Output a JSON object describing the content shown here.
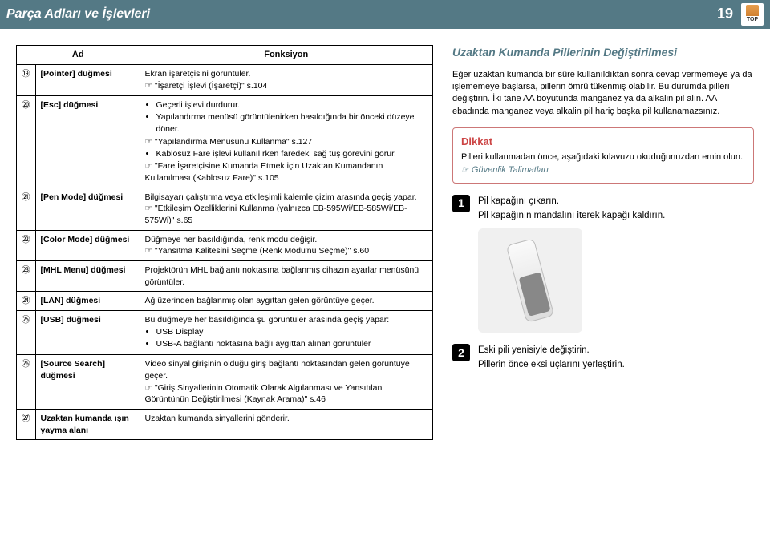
{
  "header": {
    "title": "Parça Adları ve İşlevleri",
    "page": "19",
    "logo": "TOP"
  },
  "table": {
    "col_name": "Ad",
    "col_func": "Fonksiyon",
    "rows": [
      {
        "num": "⑲",
        "name": "[Pointer] düğmesi",
        "func_text": "Ekran işaretçisini görüntüler.",
        "ref": "\"İşaretçi İşlevi (İşaretçi)\" s.104"
      },
      {
        "num": "⑳",
        "name": "[Esc] düğmesi",
        "bullets": [
          "Geçerli işlevi durdurur.",
          "Yapılandırma menüsü görüntülenirken basıldığında bir önceki düzeye döner."
        ],
        "ref1": "\"Yapılandırma Menüsünü Kullanma\" s.127",
        "bullets2": [
          "Kablosuz Fare işlevi kullanılırken faredeki sağ tuş görevini görür."
        ],
        "ref2": "\"Fare İşaretçisine Kumanda Etmek için Uzaktan Kumandanın Kullanılması (Kablosuz Fare)\" s.105"
      },
      {
        "num": "㉑",
        "name": "[Pen Mode] düğmesi",
        "func_text": "Bilgisayarı çalıştırma veya etkileşimli kalemle çizim arasında geçiş yapar.",
        "ref": "\"Etkileşim Özelliklerini Kullanma (yalnızca EB-595Wi/EB-585Wi/EB-575Wi)\" s.65"
      },
      {
        "num": "㉒",
        "name": "[Color Mode] düğmesi",
        "func_text": "Düğmeye her basıldığında, renk modu değişir.",
        "ref": "\"Yansıtma Kalitesini Seçme (Renk Modu'nu Seçme)\" s.60"
      },
      {
        "num": "㉓",
        "name": "[MHL Menu] düğmesi",
        "func_text": "Projektörün MHL bağlantı noktasına bağlanmış cihazın ayarlar menüsünü görüntüler."
      },
      {
        "num": "㉔",
        "name": "[LAN] düğmesi",
        "func_text": "Ağ üzerinden bağlanmış olan aygıttan gelen görüntüye geçer."
      },
      {
        "num": "㉕",
        "name": "[USB] düğmesi",
        "func_text": "Bu düğmeye her basıldığında şu görüntüler arasında geçiş yapar:",
        "bullets": [
          "USB Display",
          "USB-A bağlantı noktasına bağlı aygıttan alınan görüntüler"
        ]
      },
      {
        "num": "㉖",
        "name": "[Source Search] düğmesi",
        "func_text": "Video sinyal girişinin olduğu giriş bağlantı noktasından gelen görüntüye geçer.",
        "ref": "\"Giriş Sinyallerinin Otomatik Olarak Algılanması ve Yansıtılan Görüntünün Değiştirilmesi (Kaynak Arama)\" s.46"
      },
      {
        "num": "㉗",
        "name": "Uzaktan kumanda ışın yayma alanı",
        "func_text": "Uzaktan kumanda sinyallerini gönderir."
      }
    ]
  },
  "right": {
    "title": "Uzaktan Kumanda Pillerinin Değiştirilmesi",
    "para": "Eğer uzaktan kumanda bir süre kullanıldıktan sonra cevap vermemeye ya da işlememeye başlarsa, pillerin ömrü tükenmiş olabilir. Bu durumda pilleri değiştirin. İki tane AA boyutunda manganez ya da alkalin pil alın. AA ebadında manganez veya alkalin pil hariç başka pil kullanamazsınız.",
    "caution": {
      "title": "Dikkat",
      "text": "Pilleri kullanmadan önce, aşağıdaki kılavuzu okuduğunuzdan emin olun.",
      "link": "Güvenlik Talimatları"
    },
    "steps": [
      {
        "num": "1",
        "line1": "Pil kapağını çıkarın.",
        "line2": "Pil kapağının mandalını iterek kapağı kaldırın."
      },
      {
        "num": "2",
        "line1": "Eski pili yenisiyle değiştirin.",
        "line2": "Pillerin önce eksi uçlarını yerleştirin."
      }
    ]
  }
}
